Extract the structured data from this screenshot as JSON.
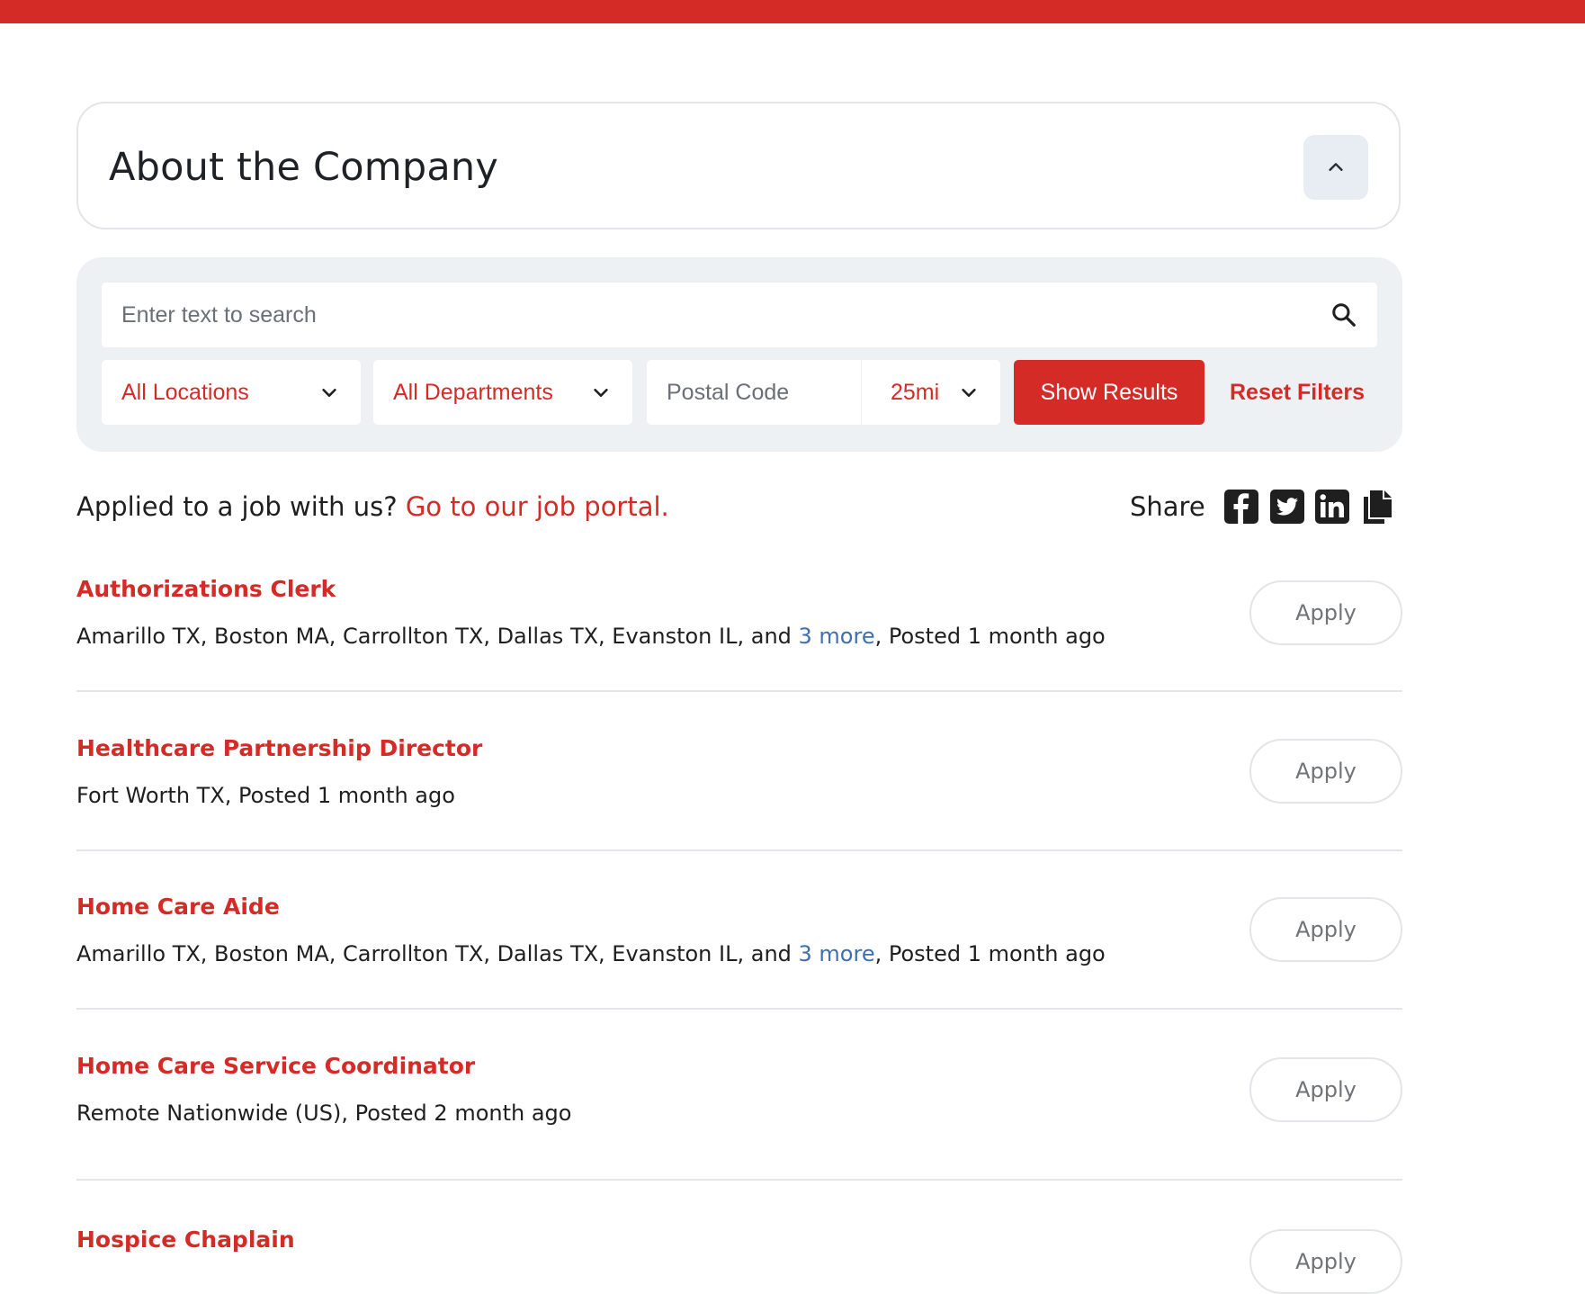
{
  "colors": {
    "brand": "#d52b27",
    "link_more": "#3f6fb3",
    "panel": "#eef1f4"
  },
  "about": {
    "title": "About the Company",
    "toggle_icon": "chevron-up-icon"
  },
  "search": {
    "placeholder": "Enter text to search",
    "icon": "search-icon"
  },
  "filters": {
    "location": "All Locations",
    "department": "All Departments",
    "postal_placeholder": "Postal Code",
    "radius": "25mi",
    "show_results": "Show Results",
    "reset": "Reset Filters"
  },
  "portal": {
    "prompt": "Applied to a job with us?",
    "link": "Go to our job portal."
  },
  "share": {
    "label": "Share",
    "icons": [
      "facebook-icon",
      "twitter-icon",
      "linkedin-icon",
      "copy-icon"
    ]
  },
  "jobs": [
    {
      "title": "Authorizations Clerk",
      "locations": "Amarillo TX, Boston MA, Carrollton TX, Dallas TX, Evanston IL, and ",
      "more": "3 more",
      "posted": ", Posted 1 month ago",
      "apply": "Apply"
    },
    {
      "title": "Healthcare Partnership Director",
      "locations": "Fort Worth TX, Posted 1 month ago",
      "more": "",
      "posted": "",
      "apply": "Apply"
    },
    {
      "title": "Home Care Aide",
      "locations": "Amarillo TX, Boston MA, Carrollton TX, Dallas TX, Evanston IL, and ",
      "more": "3 more",
      "posted": ", Posted 1 month ago",
      "apply": "Apply"
    },
    {
      "title": "Home Care Service Coordinator",
      "locations": "Remote Nationwide (US), Posted 2 month ago",
      "more": "",
      "posted": "",
      "apply": "Apply"
    },
    {
      "title": "Hospice Chaplain",
      "locations": "",
      "more": "",
      "posted": "",
      "apply": "Apply"
    }
  ]
}
